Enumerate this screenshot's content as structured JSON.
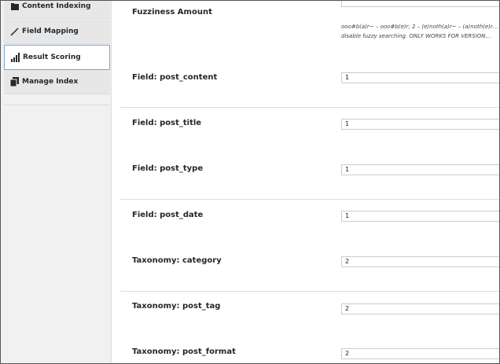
{
  "sidebar": {
    "items": [
      {
        "label": "Content Indexing",
        "icon": "folder-icon"
      },
      {
        "label": "Field Mapping",
        "icon": "pencil-icon"
      },
      {
        "label": "Result Scoring",
        "icon": "bars-icon"
      },
      {
        "label": "Manage Index",
        "icon": "documents-icon"
      }
    ],
    "active": "Result Scoring"
  },
  "fuzziness": {
    "label": "Fuzziness Amount",
    "desc_line1": "ooo#b(a)r~ – ooo#b(e)r; 2 – (e)noth(a)r~ – (a)noth(e)r…",
    "desc_line2": "disable fuzzy searching. ONLY WORKS FOR VERSION…"
  },
  "fields": [
    {
      "label": "Field: post_content",
      "value": "1"
    },
    {
      "label": "Field: post_title",
      "value": "1"
    },
    {
      "label": "Field: post_type",
      "value": "1"
    },
    {
      "label": "Field: post_date",
      "value": "1"
    },
    {
      "label": "Taxonomy: category",
      "value": "2"
    },
    {
      "label": "Taxonomy: post_tag",
      "value": "2"
    },
    {
      "label": "Taxonomy: post_format",
      "value": "2"
    }
  ],
  "colors": {
    "accent": "#7aa6d6",
    "sidebar_bg": "#f1f1f1",
    "divider": "#dcdcdc"
  }
}
